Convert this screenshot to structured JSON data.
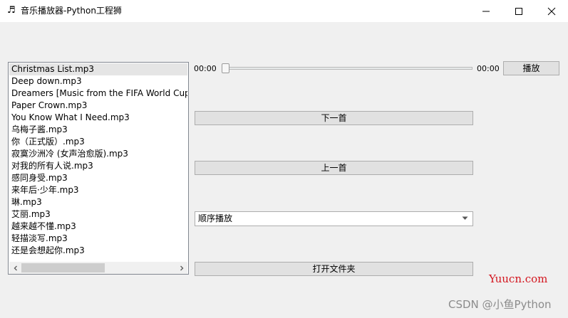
{
  "window": {
    "icon": "music-note-icon",
    "title": "音乐播放器-Python工程狮",
    "minimize_icon": "minimize-icon",
    "maximize_icon": "maximize-icon",
    "close_icon": "close-icon"
  },
  "playlist": {
    "items": [
      "Christmas List.mp3",
      "Deep down.mp3",
      "Dreamers [Music from the FIFA World Cup",
      "Paper Crown.mp3",
      "You Know What I Need.mp3",
      "乌梅子酱.mp3",
      "你（正式版）.mp3",
      "寂寞沙洲冷 (女声治愈版).mp3",
      "对我的所有人说.mp3",
      "感同身受.mp3",
      "来年后·少年.mp3",
      "琳.mp3",
      "艾丽.mp3",
      "越来越不懂.mp3",
      "轻描淡写.mp3",
      "还是会想起你.mp3"
    ],
    "selected_index": 0
  },
  "player": {
    "current_time": "00:00",
    "total_time": "00:00",
    "progress": 0,
    "play_label": "播放",
    "next_label": "下一首",
    "prev_label": "上一首",
    "mode_value": "顺序播放",
    "open_folder_label": "打开文件夹"
  },
  "watermark": {
    "site": "Yuucn.com",
    "csdn": "CSDN @小鱼Python"
  },
  "colors": {
    "watermark_red": "#d3151e",
    "selected_row": "#e5e5e5"
  }
}
